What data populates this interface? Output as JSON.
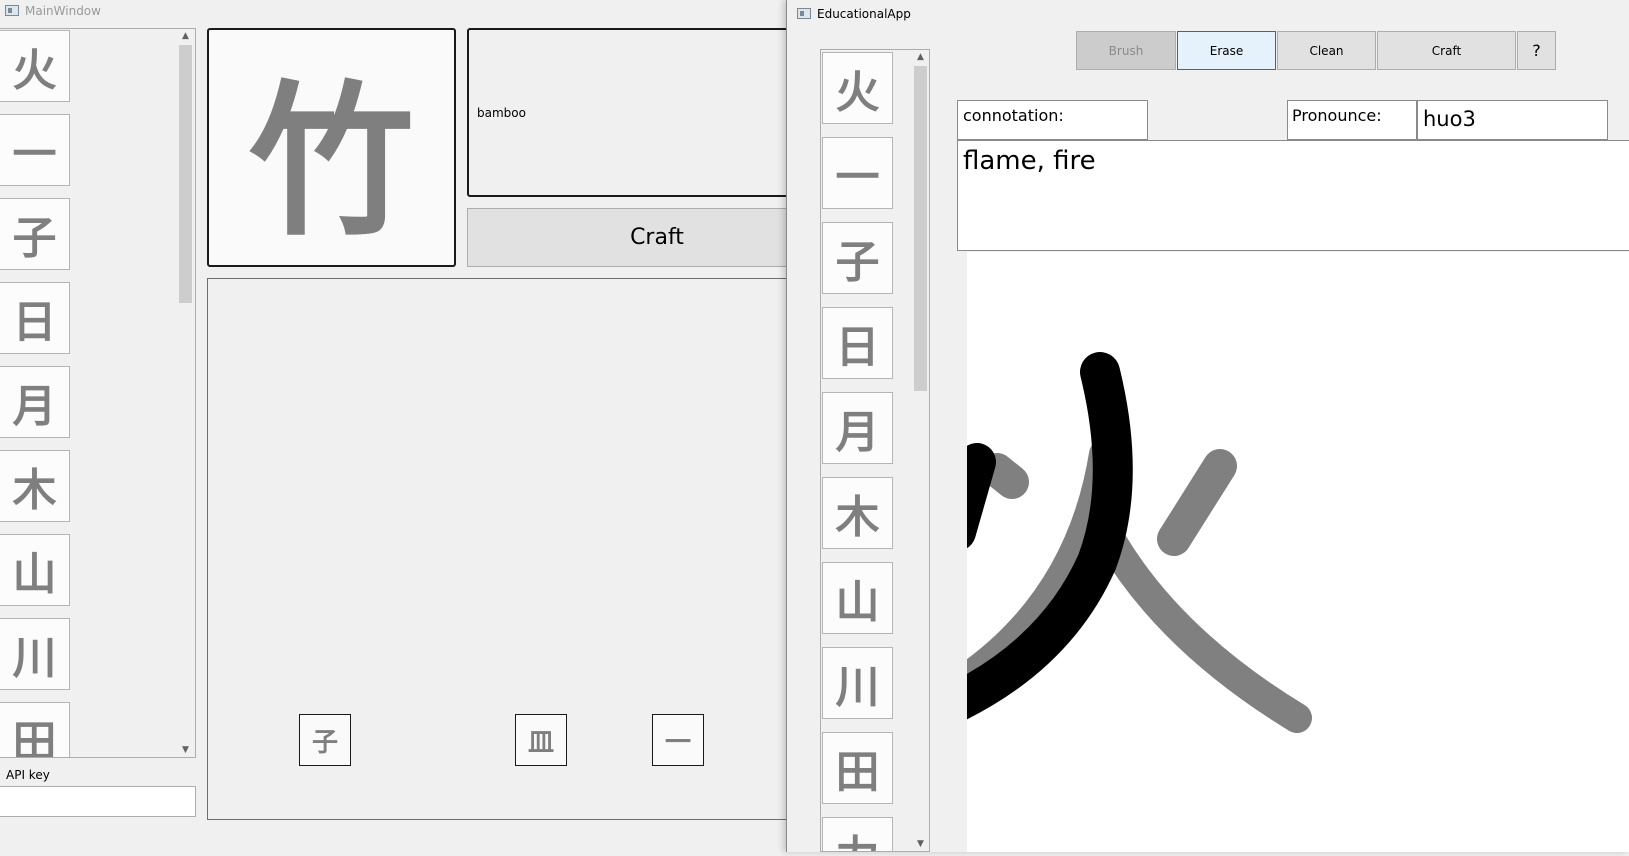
{
  "main_window": {
    "title": "MainWindow",
    "characters": [
      "火",
      "一",
      "子",
      "日",
      "月",
      "木",
      "山",
      "川",
      "田"
    ],
    "api_key_label": "API key",
    "api_key_value": "",
    "selected_character": "竹",
    "selected_meaning": "bamboo",
    "craft_label": "Craft",
    "canvas_pieces": [
      "子",
      "皿",
      "一"
    ]
  },
  "edu_app": {
    "title": "EducationalApp",
    "toolbar": {
      "brush": "Brush",
      "erase": "Erase",
      "clean": "Clean",
      "craft": "Craft",
      "help": "?"
    },
    "characters": [
      "火",
      "一",
      "子",
      "日",
      "月",
      "木",
      "山",
      "川",
      "田",
      "力"
    ],
    "connotation_label": "connotation:",
    "pronounce_label": "Pronounce:",
    "pronounce_value": "huo3",
    "connotation_value": "flame, fire"
  },
  "colors": {
    "window_bg": "#f0f0f0",
    "tile_glyph": "#7f7f7f",
    "erase_active_bg": "#e5f1fb",
    "erase_active_border": "#0078d7",
    "brush_disabled_bg": "#cccccc"
  },
  "icons": [
    "window-icon",
    "scroll-up-icon",
    "scroll-down-icon"
  ]
}
